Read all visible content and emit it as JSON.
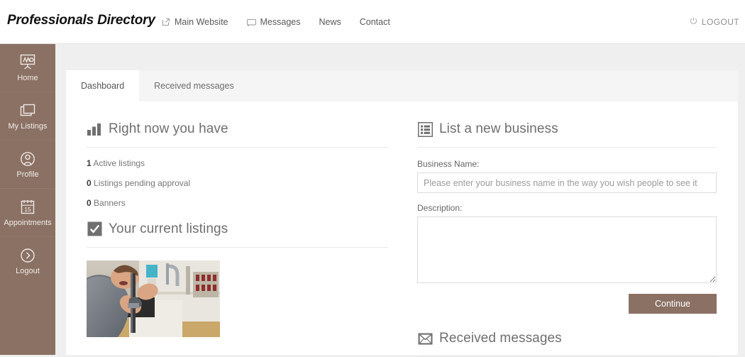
{
  "colors": {
    "brand": "#8a7164",
    "page_bg": "#efefef",
    "card_bg": "#ffffff",
    "tabstrip_bg": "#f5f5f5",
    "heading": "#6f6f6f",
    "muted_text": "#777777",
    "border": "#dcdcdc"
  },
  "header": {
    "logo": "Professionals Directory",
    "nav": [
      {
        "label": "Main Website",
        "icon": "external-link-icon"
      },
      {
        "label": "Messages",
        "icon": "envelope-icon"
      },
      {
        "label": "News",
        "icon": ""
      },
      {
        "label": "Contact",
        "icon": ""
      }
    ],
    "logout": {
      "label": "LOGOUT",
      "icon": "power-icon"
    }
  },
  "sidebar": {
    "items": [
      {
        "label": "Home",
        "icon": "presentation-board-icon"
      },
      {
        "label": "My Listings",
        "icon": "stacked-windows-icon"
      },
      {
        "label": "Profile",
        "icon": "user-circle-icon"
      },
      {
        "label": "Appointments",
        "icon": "calendar-15-icon"
      },
      {
        "label": "Logout",
        "icon": "arrow-right-circle-icon"
      }
    ]
  },
  "tabs": [
    {
      "label": "Dashboard",
      "active": true
    },
    {
      "label": "Received messages",
      "active": false
    }
  ],
  "left": {
    "stats_section": {
      "title": "Right now you have",
      "icon": "bar-chart-icon",
      "rows": [
        {
          "count": "1",
          "label": "Active listings"
        },
        {
          "count": "0",
          "label": "Listings pending approval"
        },
        {
          "count": "0",
          "label": "Banners"
        }
      ]
    },
    "listings_section": {
      "title": "Your current listings",
      "icon": "checkbox-checked-icon",
      "thumbnail_alt": "plumber working under a kitchen sink"
    }
  },
  "right": {
    "new_business_section": {
      "title": "List a new business",
      "icon": "list-icon",
      "business_name_label": "Business Name:",
      "business_name_value": "",
      "business_name_placeholder": "Please enter your business name in the way you wish people to see it",
      "description_label": "Description:",
      "description_value": "",
      "continue_label": "Continue"
    },
    "received_messages_section": {
      "title": "Received messages",
      "icon": "envelope-filled-icon"
    }
  }
}
